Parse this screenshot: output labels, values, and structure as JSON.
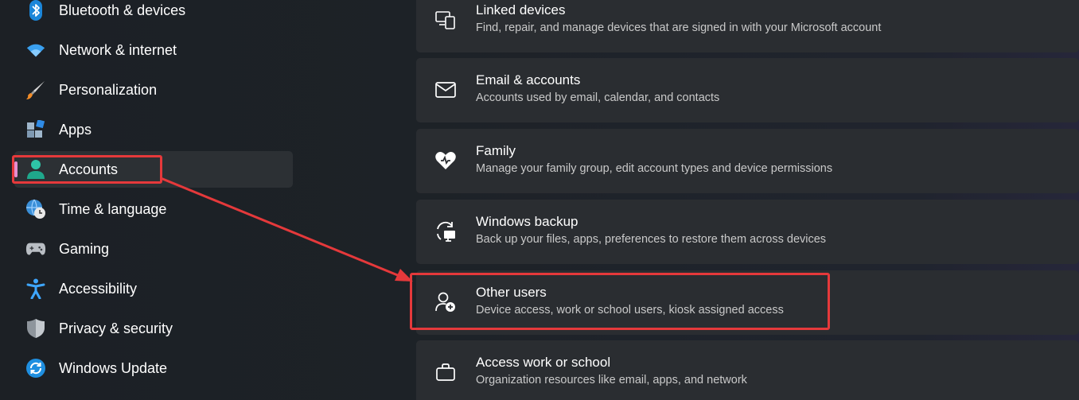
{
  "sidebar": {
    "items": [
      {
        "label": "Bluetooth & devices",
        "icon": "bluetooth-icon"
      },
      {
        "label": "Network & internet",
        "icon": "wifi-icon"
      },
      {
        "label": "Personalization",
        "icon": "paintbrush-icon"
      },
      {
        "label": "Apps",
        "icon": "apps-icon"
      },
      {
        "label": "Accounts",
        "icon": "account-icon",
        "selected": true
      },
      {
        "label": "Time & language",
        "icon": "globe-clock-icon"
      },
      {
        "label": "Gaming",
        "icon": "gamepad-icon"
      },
      {
        "label": "Accessibility",
        "icon": "accessibility-icon"
      },
      {
        "label": "Privacy & security",
        "icon": "shield-icon"
      },
      {
        "label": "Windows Update",
        "icon": "update-icon"
      }
    ]
  },
  "cards": [
    {
      "title": "Linked devices",
      "subtitle": "Find, repair, and manage devices that are signed in with your Microsoft account",
      "icon": "linked-devices-icon"
    },
    {
      "title": "Email & accounts",
      "subtitle": "Accounts used by email, calendar, and contacts",
      "icon": "mail-icon"
    },
    {
      "title": "Family",
      "subtitle": "Manage your family group, edit account types and device permissions",
      "icon": "family-heart-icon"
    },
    {
      "title": "Windows backup",
      "subtitle": "Back up your files, apps, preferences to restore them across devices",
      "icon": "backup-icon"
    },
    {
      "title": "Other users",
      "subtitle": "Device access, work or school users, kiosk assigned access",
      "icon": "add-user-icon"
    },
    {
      "title": "Access work or school",
      "subtitle": "Organization resources like email, apps, and network",
      "icon": "briefcase-icon"
    }
  ],
  "colors": {
    "accent_selected": "#e58fd0",
    "annotation_red": "#e5393b",
    "card_bg": "#2a2d31"
  }
}
